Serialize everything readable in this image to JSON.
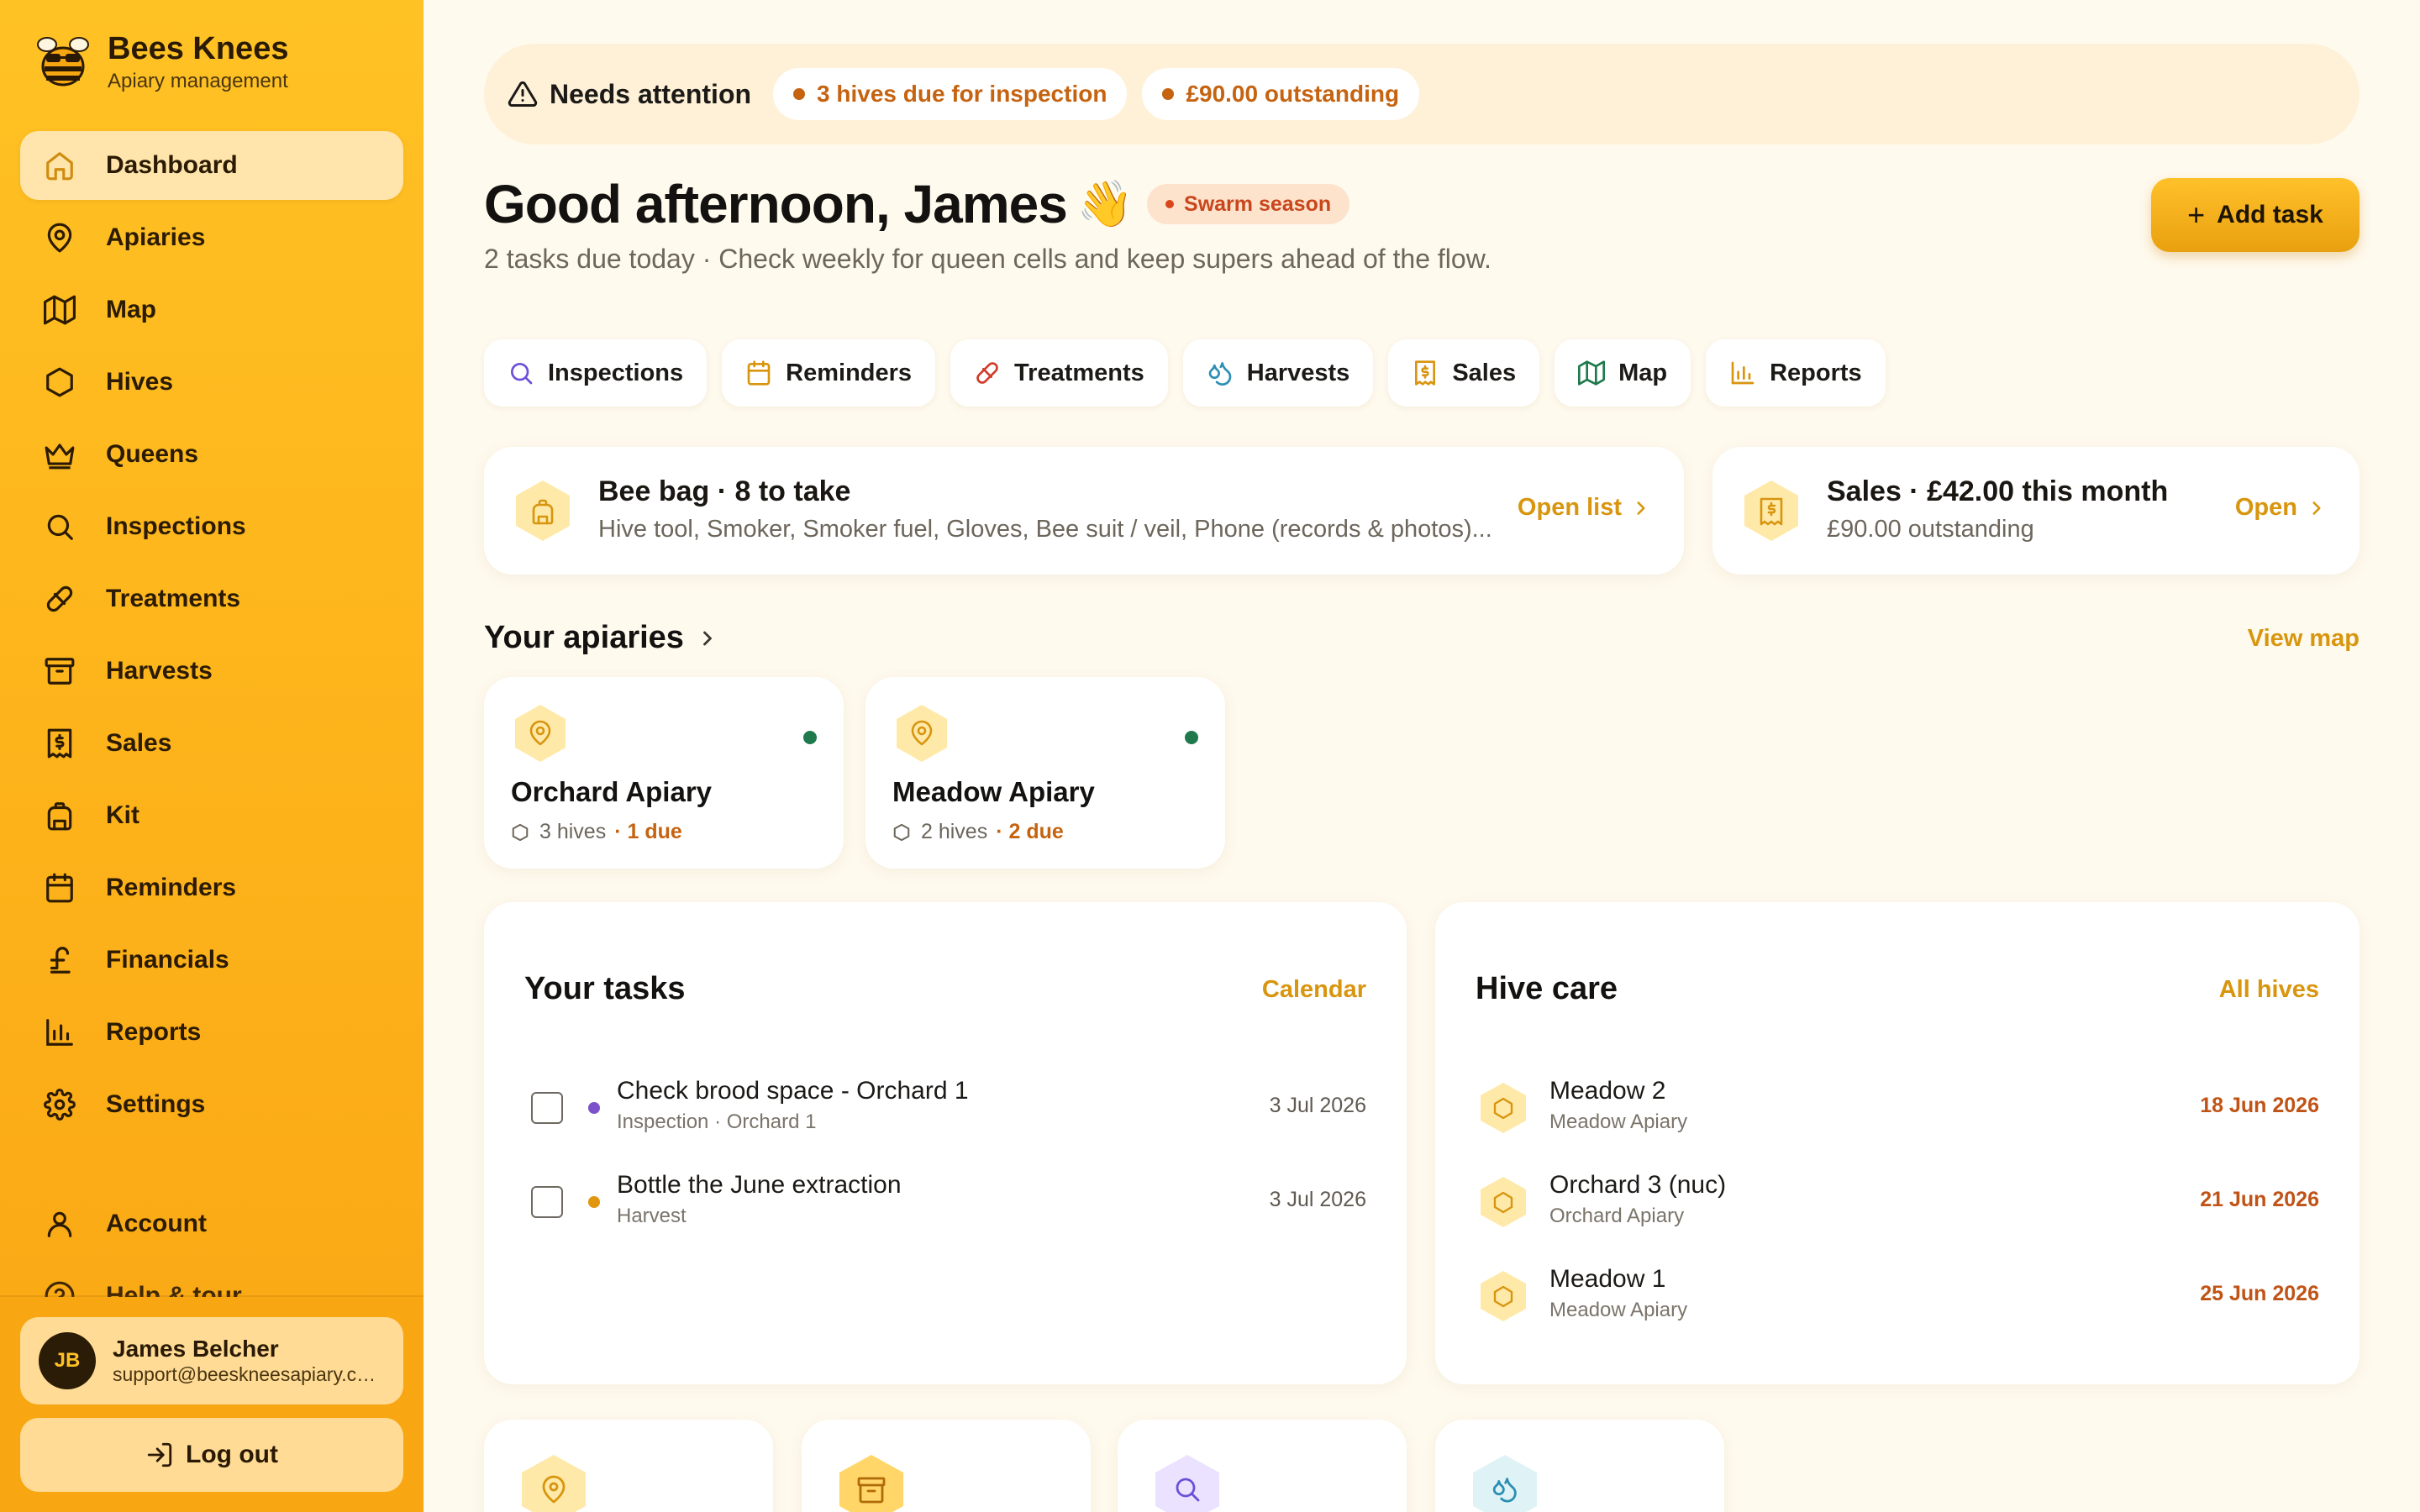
{
  "brand": {
    "name": "Bees Knees",
    "tagline": "Apiary management"
  },
  "nav": {
    "items": [
      {
        "label": "Dashboard",
        "icon": "home-icon",
        "active": true
      },
      {
        "label": "Apiaries",
        "icon": "map-pin-icon"
      },
      {
        "label": "Map",
        "icon": "map-icon"
      },
      {
        "label": "Hives",
        "icon": "hexagon-icon"
      },
      {
        "label": "Queens",
        "icon": "crown-icon"
      },
      {
        "label": "Inspections",
        "icon": "search-icon"
      },
      {
        "label": "Treatments",
        "icon": "pill-icon"
      },
      {
        "label": "Harvests",
        "icon": "archive-box-icon"
      },
      {
        "label": "Sales",
        "icon": "receipt-icon"
      },
      {
        "label": "Kit",
        "icon": "backpack-icon"
      },
      {
        "label": "Reminders",
        "icon": "calendar-icon"
      },
      {
        "label": "Financials",
        "icon": "pound-sign-icon"
      },
      {
        "label": "Reports",
        "icon": "bar-chart-icon"
      },
      {
        "label": "Settings",
        "icon": "gear-icon"
      }
    ],
    "account": "Account",
    "help": "Help & tour"
  },
  "user": {
    "initials": "JB",
    "name": "James Belcher",
    "email": "support@beeskneesapiary.co.uk"
  },
  "logout_label": "Log out",
  "attention": {
    "title": "Needs attention",
    "chips": [
      {
        "label": "3 hives due for inspection",
        "dot_color": "#c56310"
      },
      {
        "label": "£90.00 outstanding",
        "dot_color": "#c56310"
      }
    ]
  },
  "greeting": {
    "text": "Good afternoon, James",
    "emoji": "👋",
    "season_badge": "Swarm season",
    "subtitle": "2 tasks due today · Check weekly for queen cells and keep supers ahead of the flow."
  },
  "add_task_label": "Add task",
  "quick_actions": [
    {
      "label": "Inspections",
      "icon": "search-icon",
      "color": "#6c4fd6"
    },
    {
      "label": "Reminders",
      "icon": "calendar-icon",
      "color": "#d8950e"
    },
    {
      "label": "Treatments",
      "icon": "pill-icon",
      "color": "#d23a2a"
    },
    {
      "label": "Harvests",
      "icon": "droplets-icon",
      "color": "#2b8fb3"
    },
    {
      "label": "Sales",
      "icon": "receipt-icon",
      "color": "#d8950e"
    },
    {
      "label": "Map",
      "icon": "map-icon",
      "color": "#1e7a4c"
    },
    {
      "label": "Reports",
      "icon": "bar-chart-icon",
      "color": "#d8950e"
    }
  ],
  "bee_bag": {
    "title": "Bee bag · 8 to take",
    "items": "Hive tool, Smoker, Smoker fuel, Gloves, Bee suit / veil, Phone (records & photos)...",
    "link": "Open list"
  },
  "sales_card": {
    "title": "Sales · £42.00 this month",
    "subtitle": "£90.00 outstanding",
    "link": "Open"
  },
  "apiaries_section": {
    "title": "Your apiaries",
    "view_map": "View map"
  },
  "apiaries": [
    {
      "name": "Orchard Apiary",
      "hives": "3 hives",
      "due": "· 1 due",
      "status_color": "#1e7a4c"
    },
    {
      "name": "Meadow Apiary",
      "hives": "2 hives",
      "due": "· 2 due",
      "status_color": "#1e7a4c"
    }
  ],
  "tasks": {
    "title": "Your tasks",
    "link": "Calendar",
    "rows": [
      {
        "title": "Check brood space - Orchard 1",
        "sub": "Inspection · Orchard 1",
        "date": "3 Jul 2026",
        "dot_color": "#7b52c9"
      },
      {
        "title": "Bottle the June extraction",
        "sub": "Harvest",
        "date": "3 Jul 2026",
        "dot_color": "#e0960f"
      }
    ]
  },
  "hive_care": {
    "title": "Hive care",
    "link": "All hives",
    "rows": [
      {
        "name": "Meadow 2",
        "apiary": "Meadow Apiary",
        "date": "18 Jun 2026"
      },
      {
        "name": "Orchard 3 (nuc)",
        "apiary": "Orchard Apiary",
        "date": "21 Jun 2026"
      },
      {
        "name": "Meadow 1",
        "apiary": "Meadow Apiary",
        "date": "25 Jun 2026"
      }
    ]
  },
  "bottom_cards": [
    {
      "icon": "map-pin-icon",
      "color": "#ffe9a8"
    },
    {
      "icon": "archive-box-icon",
      "color": "#ffd667"
    },
    {
      "icon": "search-icon",
      "color": "#ebe2ff"
    },
    {
      "icon": "droplets-icon",
      "color": "#dff3f6"
    }
  ],
  "colors": {
    "accent": "#d8950e",
    "sidebar": "#fdb21a",
    "warning": "#c56310",
    "ok": "#1e7a4c"
  }
}
